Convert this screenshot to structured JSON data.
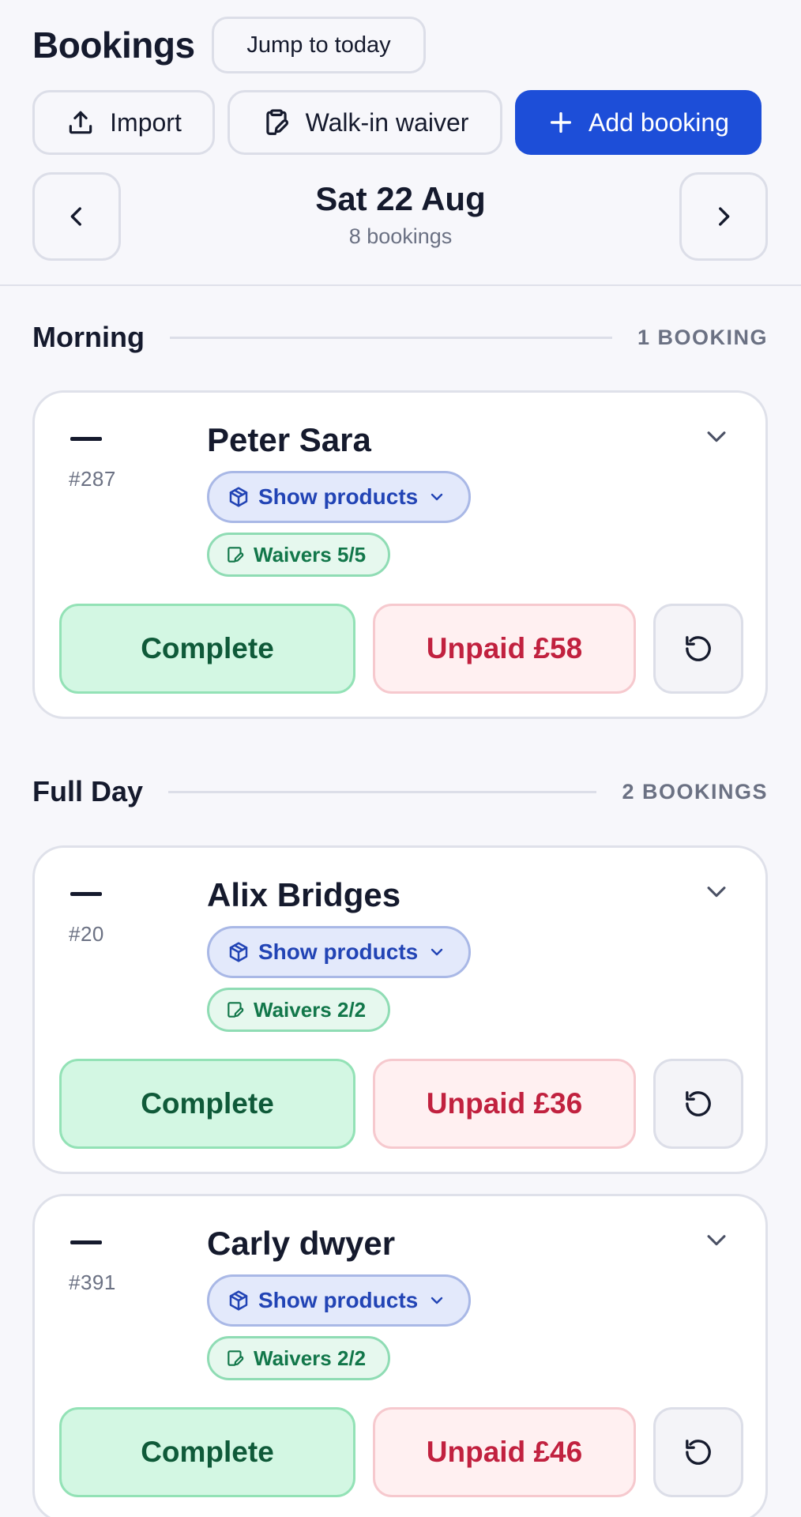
{
  "header": {
    "title": "Bookings",
    "jump_label": "Jump to today",
    "import_label": "Import",
    "waiver_label": "Walk-in waiver",
    "add_label": "Add booking",
    "date": "Sat 22 Aug",
    "booking_count": "8 bookings"
  },
  "colors": {
    "accent": "#1d4ed8",
    "complete_bg": "#d3f7e3",
    "unpaid_text": "#c1213f",
    "waiver_text": "#12774a"
  },
  "sections": [
    {
      "title": "Morning",
      "count": "1 BOOKING",
      "bookings": [
        {
          "id": "#287",
          "name": "Peter Sara",
          "products_label": "Show products",
          "waivers": "Waivers 5/5",
          "status": "Complete",
          "payment": "Unpaid £58"
        }
      ]
    },
    {
      "title": "Full Day",
      "count": "2 BOOKINGS",
      "bookings": [
        {
          "id": "#20",
          "name": "Alix Bridges",
          "products_label": "Show products",
          "waivers": "Waivers 2/2",
          "status": "Complete",
          "payment": "Unpaid £36"
        },
        {
          "id": "#391",
          "name": "Carly dwyer",
          "products_label": "Show products",
          "waivers": "Waivers 2/2",
          "status": "Complete",
          "payment": "Unpaid £46"
        }
      ]
    }
  ]
}
